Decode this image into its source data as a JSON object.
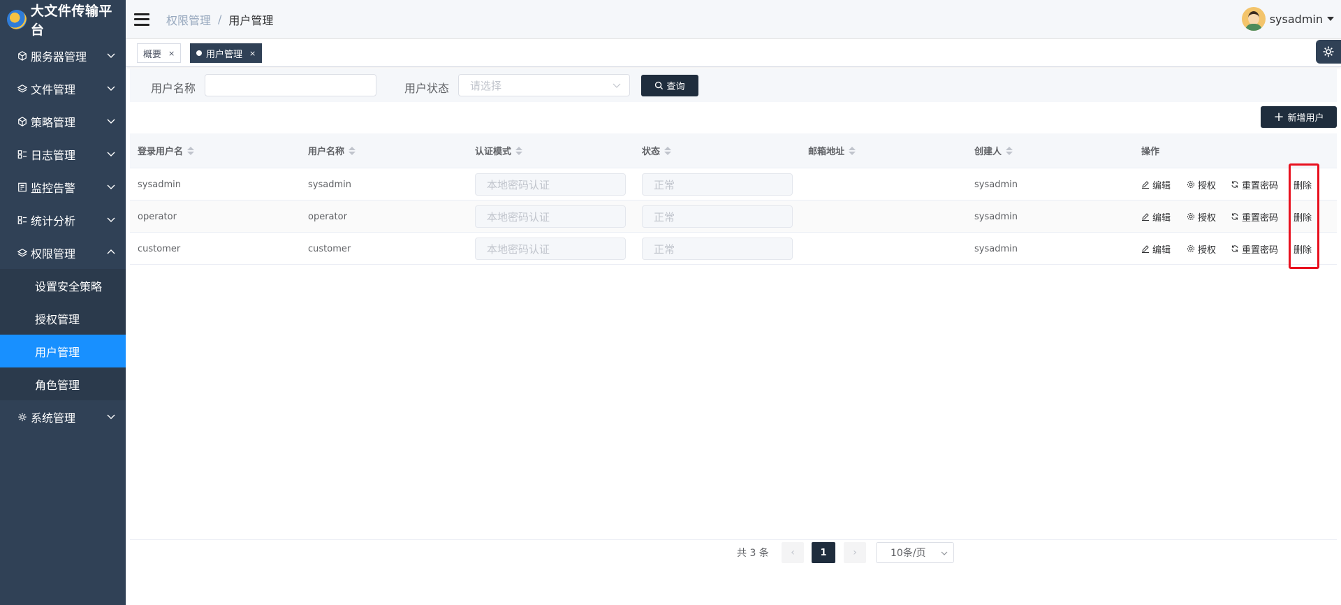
{
  "app": {
    "title": "大文件传输平台"
  },
  "sidebar": {
    "items": [
      {
        "label": "服务器管理",
        "icon": "cube-icon"
      },
      {
        "label": "文件管理",
        "icon": "layers-icon"
      },
      {
        "label": "策略管理",
        "icon": "cube-icon"
      },
      {
        "label": "日志管理",
        "icon": "list-icon"
      },
      {
        "label": "监控告警",
        "icon": "monitor-icon"
      },
      {
        "label": "统计分析",
        "icon": "list-icon"
      },
      {
        "label": "权限管理",
        "icon": "layers-icon"
      },
      {
        "label": "系统管理",
        "icon": "gear-icon"
      }
    ],
    "subitems": [
      {
        "label": "设置安全策略"
      },
      {
        "label": "授权管理"
      },
      {
        "label": "用户管理"
      },
      {
        "label": "角色管理"
      }
    ]
  },
  "header": {
    "breadcrumb": [
      "权限管理",
      "用户管理"
    ],
    "separator": "/",
    "username": "sysadmin"
  },
  "tags": [
    {
      "label": "概要",
      "close": "×"
    },
    {
      "label": "用户管理",
      "close": "×"
    }
  ],
  "search": {
    "username_label": "用户名称",
    "username_value": "",
    "status_label": "用户状态",
    "status_placeholder": "请选择",
    "query_label": "查询"
  },
  "add_button_label": "新增用户",
  "table": {
    "columns": [
      "登录用户名",
      "用户名称",
      "认证模式",
      "状态",
      "邮箱地址",
      "创建人",
      "操作"
    ],
    "rows": [
      {
        "login": "sysadmin",
        "name": "sysadmin",
        "auth": "本地密码认证",
        "status": "正常",
        "email": "",
        "creator": "sysadmin"
      },
      {
        "login": "operator",
        "name": "operator",
        "auth": "本地密码认证",
        "status": "正常",
        "email": "",
        "creator": "sysadmin"
      },
      {
        "login": "customer",
        "name": "customer",
        "auth": "本地密码认证",
        "status": "正常",
        "email": "",
        "creator": "sysadmin"
      }
    ],
    "actions": {
      "edit": "编辑",
      "authorize": "授权",
      "reset": "重置密码",
      "delete": "删除"
    }
  },
  "pagination": {
    "total_text": "共 3 条",
    "current_page": "1",
    "page_size": "10条/页",
    "prev": "‹",
    "next": "›"
  },
  "colors": {
    "sidebar_bg": "#304156",
    "active_menu": "#1890ff",
    "primary_dark": "#1f2d3d",
    "highlight": "#e8101e"
  }
}
